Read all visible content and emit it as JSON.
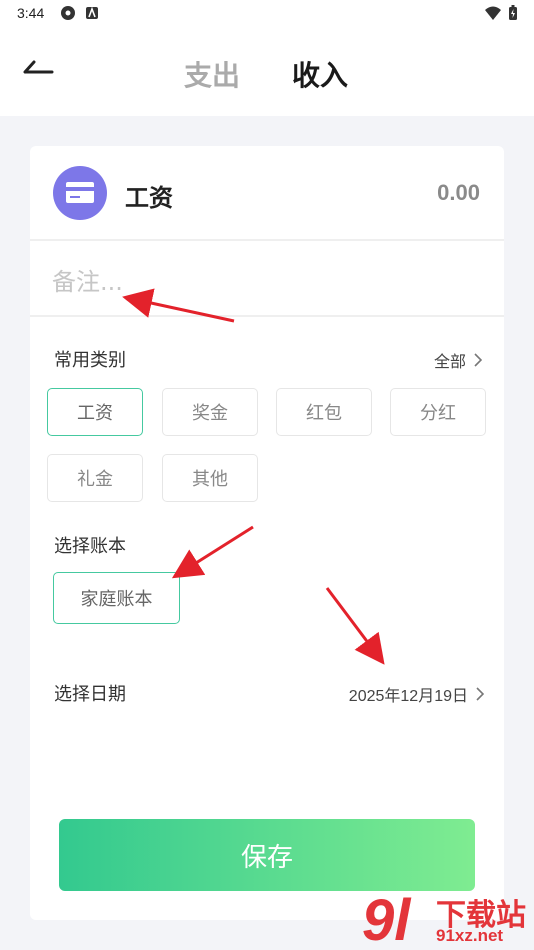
{
  "status_bar": {
    "time": "3:44"
  },
  "header": {
    "tabs": [
      {
        "label": "支出",
        "active": false
      },
      {
        "label": "收入",
        "active": true
      }
    ]
  },
  "category": {
    "name": "工资",
    "amount": "0.00",
    "icon": "card-icon",
    "icon_color": "#7d77e8"
  },
  "note": {
    "placeholder": "备注..."
  },
  "common_categories": {
    "label": "常用类别",
    "all_label": "全部",
    "items": [
      {
        "label": "工资",
        "selected": true
      },
      {
        "label": "奖金",
        "selected": false
      },
      {
        "label": "红包",
        "selected": false
      },
      {
        "label": "分红",
        "selected": false
      },
      {
        "label": "礼金",
        "selected": false
      },
      {
        "label": "其他",
        "selected": false
      }
    ]
  },
  "account_book": {
    "label": "选择账本",
    "selected": "家庭账本"
  },
  "date": {
    "label": "选择日期",
    "value": "2025年12月19日"
  },
  "save_label": "保存",
  "watermark": {
    "text": "下载站",
    "url": "91xz.net",
    "logo": "9l"
  },
  "colors": {
    "accent": "#45c9a0",
    "button_start": "#33c98f",
    "button_end": "#7fec91",
    "annotation": "#e3222b"
  }
}
